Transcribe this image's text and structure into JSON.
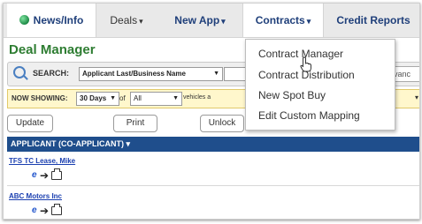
{
  "nav": {
    "tabs": [
      {
        "label": "News/Info"
      },
      {
        "label": "Deals",
        "caret": "▾"
      },
      {
        "label": "New App",
        "caret": "▾"
      },
      {
        "label": "Contracts",
        "caret": "▾"
      },
      {
        "label": "Credit Reports"
      }
    ]
  },
  "page": {
    "title": "Deal Manager"
  },
  "search": {
    "label": "SEARCH:",
    "type_value": "Applicant Last/Business Name",
    "input_value": "",
    "advanced_label": "Advanc"
  },
  "showing": {
    "label": "NOW SHOWING:",
    "days_value": "30 Days",
    "of_label": "of",
    "scope_value": "All",
    "vehicles_label": "vehicles a"
  },
  "buttons": {
    "update": "Update",
    "print": "Print",
    "unlock": "Unlock"
  },
  "table": {
    "header": "APPLICANT (CO-APPLICANT) ▾",
    "rows": [
      {
        "name": "TFS TC Lease, Mike",
        "e_label": "e"
      },
      {
        "name": "ABC Motors Inc",
        "e_label": "e"
      }
    ]
  },
  "contracts_menu": {
    "items": [
      "Contract Manager",
      "Contract Distribution",
      "New Spot Buy",
      "Edit Custom Mapping"
    ]
  },
  "colors": {
    "title_green": "#2e7d32",
    "header_blue": "#1f4e8c",
    "nav_blue": "#1f3f7a",
    "showing_yellow": "#fff7cc"
  }
}
